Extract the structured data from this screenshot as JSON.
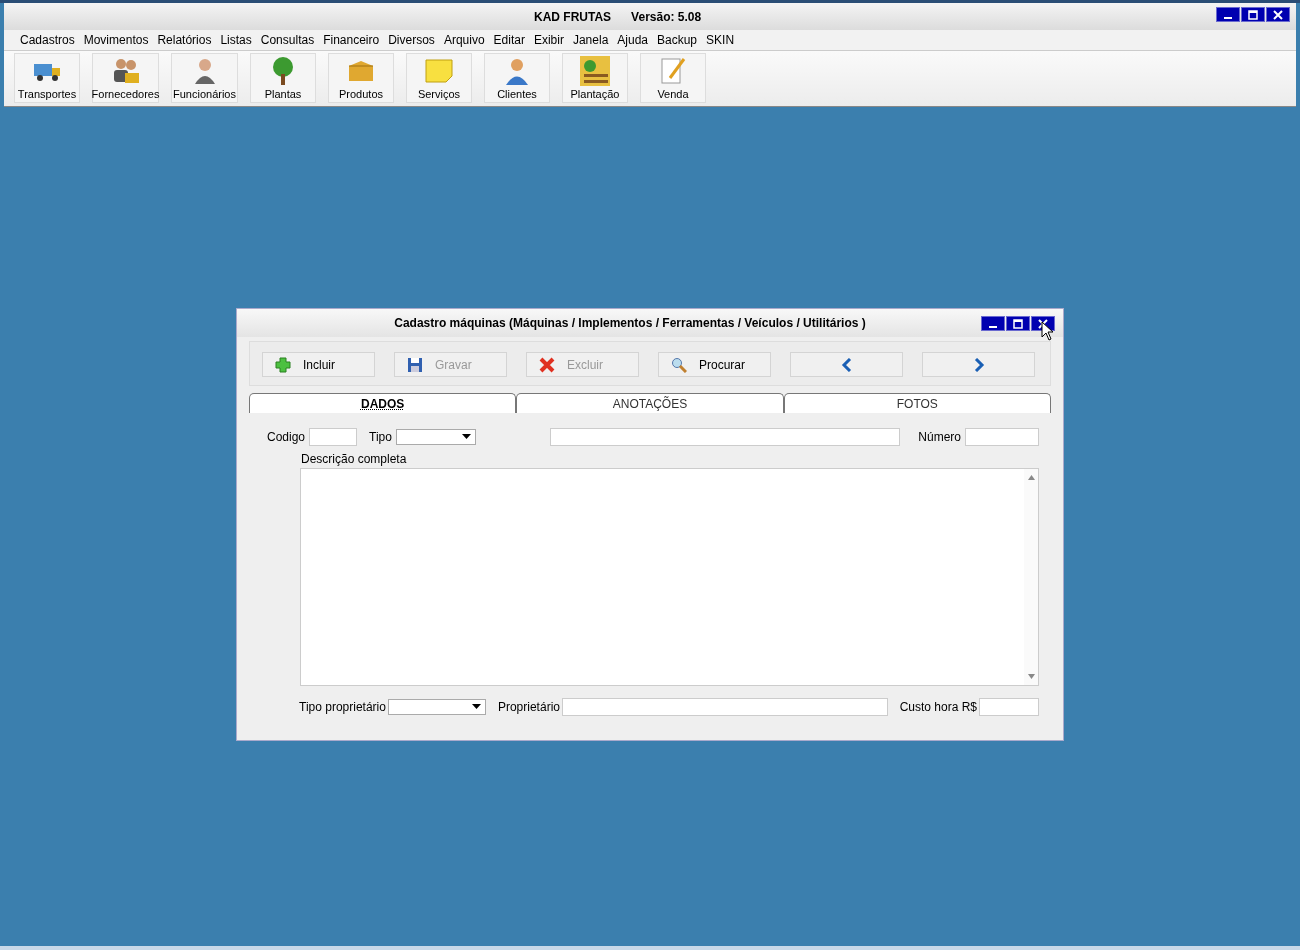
{
  "app": {
    "title": "KAD FRUTAS",
    "version": "Versão: 5.08"
  },
  "menu": [
    "Cadastros",
    "Movimentos",
    "Relatórios",
    "Listas",
    "Consultas",
    "Financeiro",
    "Diversos",
    "Arquivo",
    "Editar",
    "Exibir",
    "Janela",
    "Ajuda",
    "Backup",
    "SKIN"
  ],
  "toolbar": [
    {
      "label": "Transportes",
      "kind": "truck"
    },
    {
      "label": "Fornecedores",
      "kind": "people"
    },
    {
      "label": "Funcionários",
      "kind": "person"
    },
    {
      "label": "Plantas",
      "kind": "tree"
    },
    {
      "label": "Produtos",
      "kind": "box"
    },
    {
      "label": "Serviços",
      "kind": "note"
    },
    {
      "label": "Clientes",
      "kind": "client"
    },
    {
      "label": "Plantação",
      "kind": "farm"
    },
    {
      "label": "Venda",
      "kind": "pencil"
    }
  ],
  "dialog": {
    "title": "Cadastro máquinas (Máquinas / Implementos / Ferramentas / Veículos / Utilitários )",
    "buttons": [
      {
        "label": "Incluir",
        "kind": "plus",
        "disabled": false
      },
      {
        "label": "Gravar",
        "kind": "save",
        "disabled": true
      },
      {
        "label": "Excluir",
        "kind": "delete",
        "disabled": true
      },
      {
        "label": "Procurar",
        "kind": "search",
        "disabled": false
      },
      {
        "kind": "prev",
        "disabled": false
      },
      {
        "kind": "next",
        "disabled": false
      }
    ],
    "tabs": [
      {
        "label": "DADOS",
        "selected": true
      },
      {
        "label": "ANOTAÇÕES",
        "selected": false
      },
      {
        "label": "FOTOS",
        "selected": false
      }
    ],
    "fields": {
      "codigo": "Codigo",
      "tipo": "Tipo",
      "numero": "Número",
      "descricao": "Descrição completa",
      "tipo_proprietario": "Tipo proprietário",
      "proprietario": "Proprietário",
      "custo": "Custo hora R$"
    }
  }
}
